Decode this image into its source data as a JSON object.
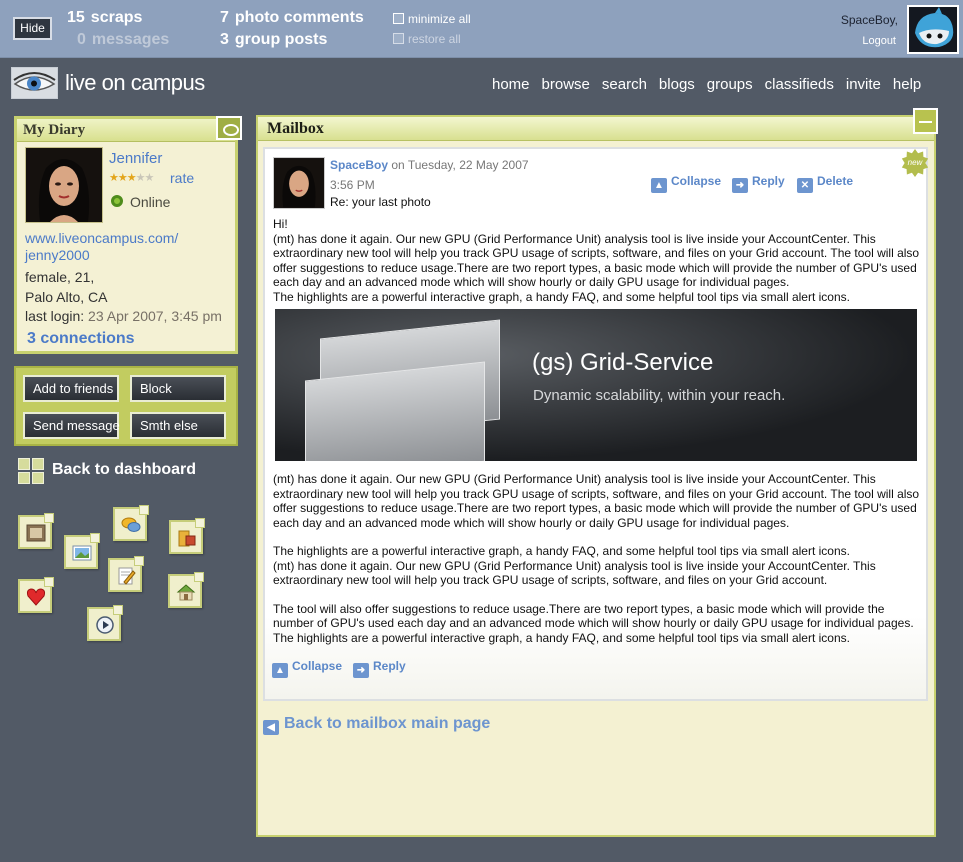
{
  "topbar": {
    "hide_label": "Hide",
    "scraps_count": "15",
    "scraps_label": "scraps",
    "messages_count": "0",
    "messages_label": "messages",
    "photo_comments_count": "7",
    "photo_comments_label": "photo comments",
    "group_posts_count": "3",
    "group_posts_label": "group posts",
    "minimize_all": "minimize all",
    "restore_all": "restore all",
    "user_name": "SpaceBoy,",
    "logout": "Logout"
  },
  "header": {
    "logo_text": "live on campus",
    "nav": [
      "home",
      "browse",
      "search",
      "blogs",
      "groups",
      "classifieds",
      "invite",
      "help"
    ]
  },
  "diary": {
    "title": "My Diary",
    "name": "Jennifer",
    "rating": 3,
    "rating_max": 5,
    "rate_label": "rate",
    "status": "Online",
    "url_line1": "www.liveoncampus.com/",
    "url_line2": "jenny2000",
    "gender_age": "female, 21,",
    "location": "Palo Alto, CA",
    "last_login_label": "last login:",
    "last_login_value": "23 Apr 2007, 3:45 pm",
    "connections": "3 connections"
  },
  "actions": {
    "add_friends": "Add to friends",
    "block": "Block",
    "send_message": "Send message",
    "smth_else": "Smth else"
  },
  "dashboard": {
    "back_label": "Back to dashboard"
  },
  "mailbox": {
    "title": "Mailbox",
    "badge": "new",
    "from_name": "SpaceBoy",
    "from_date": "on Tuesday, 22 May 2007",
    "time": "3:56 PM",
    "subject": "Re: your last photo",
    "collapse": "Collapse",
    "reply": "Reply",
    "delete": "Delete",
    "greeting": "Hi!",
    "para1": "(mt) has done it again. Our new GPU (Grid Performance Unit) analysis tool is live inside your AccountCenter. This extraordinary new tool will help you track GPU usage of scripts, software, and files on your Grid account. The tool will also offer suggestions to reduce usage.There are two report types, a basic mode which will provide the number of GPU's used each day and an advanced mode which will show hourly or daily GPU usage for individual pages.",
    "para1b": "The highlights are a powerful interactive graph, a handy FAQ, and some helpful tool tips via small alert icons.",
    "banner_title": "(gs) Grid-Service",
    "banner_subtitle": "Dynamic scalability, within your reach.",
    "para2": "(mt) has done it again. Our new GPU (Grid Performance Unit) analysis tool is live inside your AccountCenter. This extraordinary new tool will help you track GPU usage of scripts, software, and files on your Grid account. The tool will also offer suggestions to reduce usage.There are two report types, a basic mode which will provide the number of GPU's used each day and an advanced mode which will show hourly or daily GPU usage for individual pages.",
    "para3a": "The highlights are a powerful interactive graph, a handy FAQ, and some helpful tool tips via small alert icons.",
    "para3b": "(mt) has done it again. Our new GPU (Grid Performance Unit) analysis tool is live inside your AccountCenter. This extraordinary new tool will help you track GPU usage of scripts, software, and files on your Grid account.",
    "para4a": "The tool will also offer suggestions to reduce usage.There are two report types, a basic mode which will provide the number of GPU's used each day and an advanced mode which will show hourly or daily GPU usage for individual pages.",
    "para4b": "The highlights are a powerful interactive graph, a handy FAQ, and some helpful tool tips via small alert icons.",
    "back_label": "Back to mailbox main page"
  },
  "colors": {
    "link": "#4b7ac8",
    "panel_border": "#c7d16f",
    "topbar": "#8ea1bd",
    "background": "#525a66"
  }
}
